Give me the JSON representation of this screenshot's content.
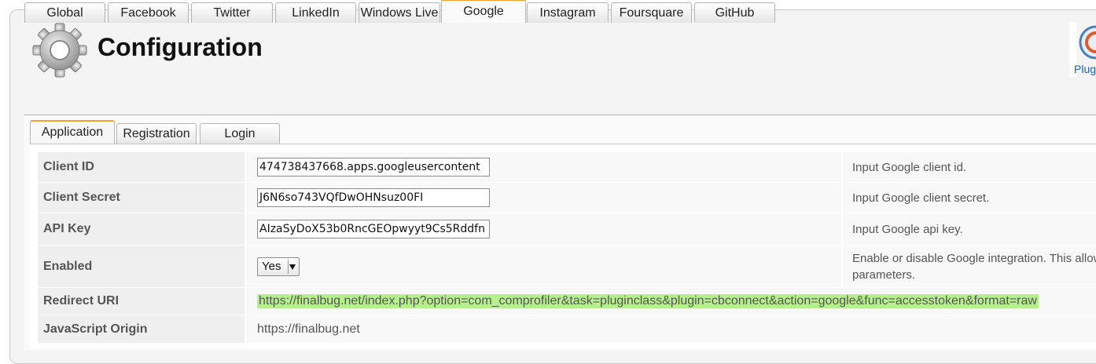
{
  "header": {
    "title": "Configuration",
    "plugin_label": "Plug",
    "gear_icon": "gear-icon",
    "plugin_icon": "plugin-logo-icon"
  },
  "main_tabs": [
    "Global",
    "Facebook",
    "Twitter",
    "LinkedIn",
    "Windows Live",
    "Google",
    "Instagram",
    "Foursquare",
    "GitHub"
  ],
  "active_main_tab": "Google",
  "sub_tabs": [
    "Application",
    "Registration",
    "Login"
  ],
  "active_sub_tab": "Application",
  "fields": {
    "client_id": {
      "label": "Client ID",
      "value": "474738437668.apps.googleusercontent",
      "description": "Input Google client id."
    },
    "client_secret": {
      "label": "Client Secret",
      "value": "J6N6so743VQfDwOHNsuz00FI",
      "description": "Input Google client secret."
    },
    "api_key": {
      "label": "API Key",
      "value": "AIzaSyDoX53b0RncGEOpwyyt9Cs5Rddfn",
      "description": "Input Google api key."
    },
    "enabled": {
      "label": "Enabled",
      "value": "Yes",
      "description_line1": "Enable or disable Google integration. This allows",
      "description_line2": "parameters."
    },
    "redirect_uri": {
      "label": "Redirect URI",
      "value": "https://finalbug.net/index.php?option=com_comprofiler&task=pluginclass&plugin=cbconnect&action=google&func=accesstoken&format=raw"
    },
    "javascript_origin": {
      "label": "JavaScript Origin",
      "value": "https://finalbug.net"
    }
  },
  "colors": {
    "active_tab_accent": "#f2a22a",
    "highlight": "#b6f08c",
    "label_bg": "#efefef"
  }
}
